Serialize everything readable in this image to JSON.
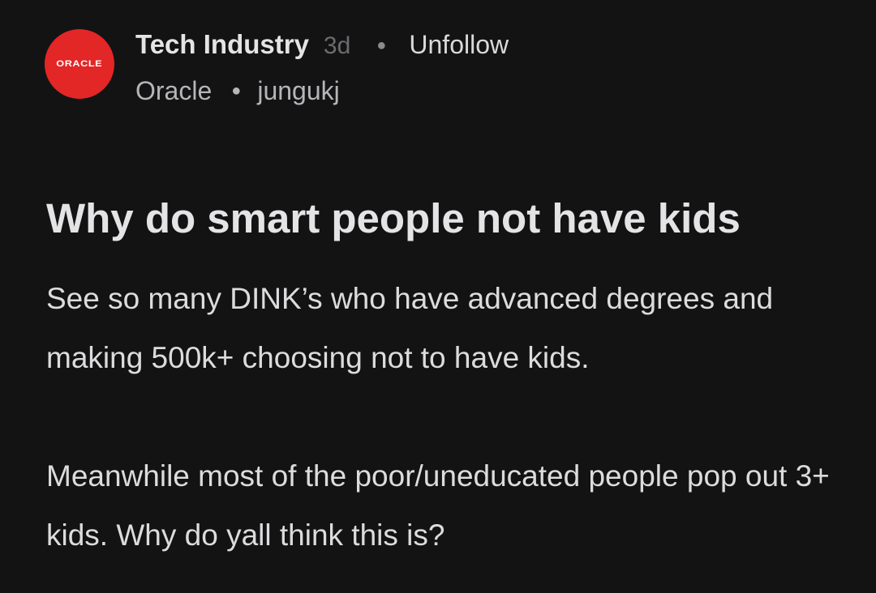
{
  "post": {
    "avatar_logo_text": "ORACLE",
    "channel": "Tech Industry",
    "time_ago": "3d",
    "unfollow_label": "Unfollow",
    "company": "Oracle",
    "username": "jungukj",
    "title": "Why do smart people not have kids",
    "body": [
      "See so many DINK’s who have advanced degrees and making 500k+ choosing not to have kids.",
      "Meanwhile most of the poor/uneducated people pop out 3+ kids. Why do yall think this is?"
    ]
  },
  "colors": {
    "background": "#131313",
    "avatar": "#e32626",
    "text_primary": "#e4e4e6",
    "text_muted": "#6b6b70"
  }
}
